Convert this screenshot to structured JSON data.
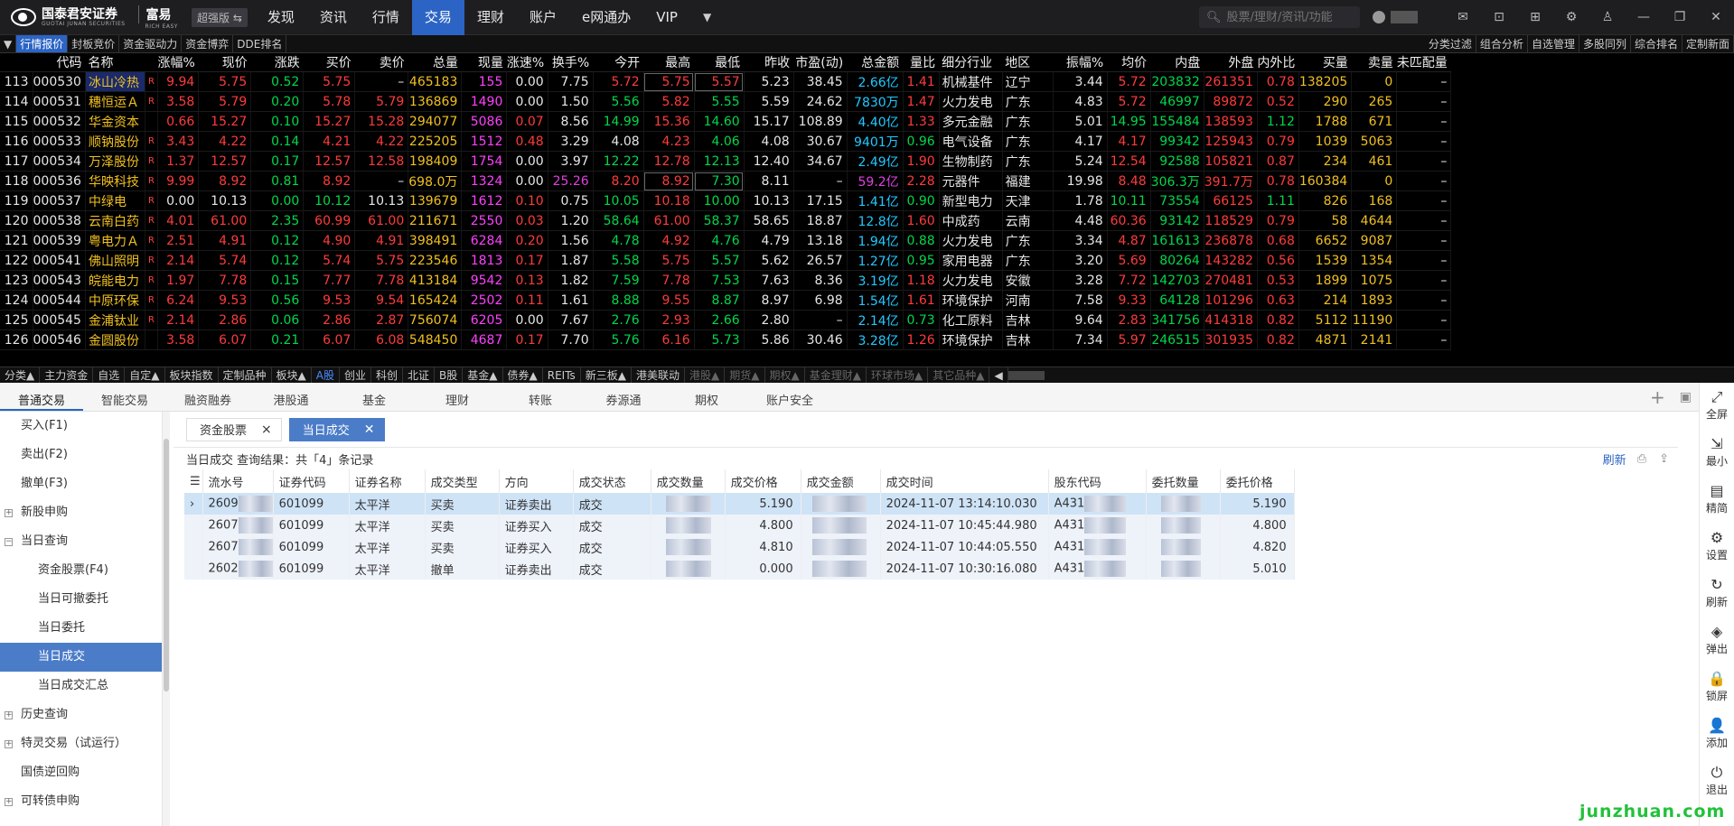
{
  "app": {
    "logo_text": "国泰君安证券",
    "logo_sub": "GUOTAI JUNAN SECURITIES",
    "product": "富易",
    "product_sub": "RICH EASY",
    "edition": "超强版 ⇆"
  },
  "nav": [
    "发现",
    "资讯",
    "行情",
    "交易",
    "理财",
    "账户",
    "e网通办",
    "VIP"
  ],
  "search": {
    "placeholder": "股票/理财/资讯/功能"
  },
  "quote_tabs": [
    "行情报价",
    "封板竞价",
    "资金驱动力",
    "资金博弈",
    "DDE排名"
  ],
  "quote_tabs_right": [
    "分类过滤",
    "组合分析",
    "自选管理",
    "多股同列",
    "综合排名",
    "定制新面"
  ],
  "columns": [
    "",
    "代码",
    "名称",
    "",
    "涨幅%",
    "现价",
    "涨跌",
    "买价",
    "卖价",
    "总量",
    "现量",
    "涨速%",
    "换手%",
    "今开",
    "最高",
    "最低",
    "昨收",
    "市盈(动)",
    "总金额",
    "量比",
    "细分行业",
    "地区",
    "振幅%",
    "均价",
    "内盘",
    "外盘",
    "内外比",
    "买量",
    "卖量",
    "未匹配量"
  ],
  "rows": [
    [
      "113",
      "000530",
      "冰山冷热",
      "R",
      "9.94",
      "5.75",
      "0.52",
      "5.75",
      "–",
      "465183",
      "155",
      "0.00",
      "7.75",
      "5.72",
      "5.75",
      "5.57",
      "5.23",
      "38.45",
      "2.66亿",
      "1.41",
      "机械基件",
      "辽宁",
      "3.44",
      "5.72",
      "203832",
      "261351",
      "0.78",
      "138205",
      "0",
      "–"
    ],
    [
      "114",
      "000531",
      "穗恒运Ａ",
      "R",
      "3.58",
      "5.79",
      "0.20",
      "5.78",
      "5.79",
      "136869",
      "1490",
      "0.00",
      "1.50",
      "5.56",
      "5.82",
      "5.55",
      "5.59",
      "24.62",
      "7830万",
      "1.47",
      "火力发电",
      "广东",
      "4.83",
      "5.72",
      "46997",
      "89872",
      "0.52",
      "290",
      "265",
      "–"
    ],
    [
      "115",
      "000532",
      "华金资本",
      "",
      "0.66",
      "15.27",
      "0.10",
      "15.27",
      "15.28",
      "294077",
      "5086",
      "0.07",
      "8.56",
      "14.99",
      "15.36",
      "14.60",
      "15.17",
      "108.89",
      "4.40亿",
      "1.33",
      "多元金融",
      "广东",
      "5.01",
      "14.95",
      "155484",
      "138593",
      "1.12",
      "1788",
      "671",
      "–"
    ],
    [
      "116",
      "000533",
      "顺钠股份",
      "R",
      "3.43",
      "4.22",
      "0.14",
      "4.21",
      "4.22",
      "225205",
      "1512",
      "0.48",
      "3.29",
      "4.08",
      "4.23",
      "4.06",
      "4.08",
      "30.67",
      "9401万",
      "0.96",
      "电气设备",
      "广东",
      "4.17",
      "4.17",
      "99342",
      "125943",
      "0.79",
      "1039",
      "5063",
      "–"
    ],
    [
      "117",
      "000534",
      "万泽股份",
      "R",
      "1.37",
      "12.57",
      "0.17",
      "12.57",
      "12.58",
      "198409",
      "1754",
      "0.00",
      "3.97",
      "12.22",
      "12.78",
      "12.13",
      "12.40",
      "34.67",
      "2.49亿",
      "1.90",
      "生物制药",
      "广东",
      "5.24",
      "12.54",
      "92588",
      "105821",
      "0.87",
      "234",
      "461",
      "–"
    ],
    [
      "118",
      "000536",
      "华映科技",
      "R",
      "9.99",
      "8.92",
      "0.81",
      "8.92",
      "–",
      "698.0万",
      "1324",
      "0.00",
      "25.26",
      "8.20",
      "8.92",
      "7.30",
      "8.11",
      "–",
      "59.2亿",
      "2.28",
      "元器件",
      "福建",
      "19.98",
      "8.48",
      "306.3万",
      "391.7万",
      "0.78",
      "160384",
      "0",
      "–"
    ],
    [
      "119",
      "000537",
      "中绿电",
      "R",
      "0.00",
      "10.13",
      "0.00",
      "10.12",
      "10.13",
      "139679",
      "1612",
      "0.10",
      "0.75",
      "10.05",
      "10.18",
      "10.00",
      "10.13",
      "17.15",
      "1.41亿",
      "0.90",
      "新型电力",
      "天津",
      "1.78",
      "10.11",
      "73554",
      "66125",
      "1.11",
      "826",
      "168",
      "–"
    ],
    [
      "120",
      "000538",
      "云南白药",
      "R",
      "4.01",
      "61.00",
      "2.35",
      "60.99",
      "61.00",
      "211671",
      "2550",
      "0.03",
      "1.20",
      "58.64",
      "61.00",
      "58.37",
      "58.65",
      "18.87",
      "12.8亿",
      "1.60",
      "中成药",
      "云南",
      "4.48",
      "60.36",
      "93142",
      "118529",
      "0.79",
      "58",
      "4644",
      "–"
    ],
    [
      "121",
      "000539",
      "粤电力Ａ",
      "R",
      "2.51",
      "4.91",
      "0.12",
      "4.90",
      "4.91",
      "398491",
      "6284",
      "0.20",
      "1.56",
      "4.78",
      "4.92",
      "4.76",
      "4.79",
      "13.18",
      "1.94亿",
      "0.88",
      "火力发电",
      "广东",
      "3.34",
      "4.87",
      "161613",
      "236878",
      "0.68",
      "6652",
      "9087",
      "–"
    ],
    [
      "122",
      "000541",
      "佛山照明",
      "R",
      "2.14",
      "5.74",
      "0.12",
      "5.74",
      "5.75",
      "223546",
      "1813",
      "0.17",
      "1.87",
      "5.58",
      "5.75",
      "5.57",
      "5.62",
      "26.57",
      "1.27亿",
      "0.95",
      "家用电器",
      "广东",
      "3.20",
      "5.69",
      "80264",
      "143282",
      "0.56",
      "1539",
      "1354",
      "–"
    ],
    [
      "123",
      "000543",
      "皖能电力",
      "R",
      "1.97",
      "7.78",
      "0.15",
      "7.77",
      "7.78",
      "413184",
      "9542",
      "0.13",
      "1.82",
      "7.59",
      "7.78",
      "7.53",
      "7.63",
      "8.36",
      "3.19亿",
      "1.18",
      "火力发电",
      "安徽",
      "3.28",
      "7.72",
      "142703",
      "270481",
      "0.53",
      "1899",
      "1075",
      "–"
    ],
    [
      "124",
      "000544",
      "中原环保",
      "R",
      "6.24",
      "9.53",
      "0.56",
      "9.53",
      "9.54",
      "165424",
      "2502",
      "0.11",
      "1.61",
      "8.88",
      "9.55",
      "8.87",
      "8.97",
      "6.98",
      "1.54亿",
      "1.61",
      "环境保护",
      "河南",
      "7.58",
      "9.33",
      "64128",
      "101296",
      "0.63",
      "214",
      "1893",
      "–"
    ],
    [
      "125",
      "000545",
      "金浦钛业",
      "R",
      "2.14",
      "2.86",
      "0.06",
      "2.86",
      "2.87",
      "756074",
      "6205",
      "0.00",
      "7.67",
      "2.76",
      "2.93",
      "2.66",
      "2.80",
      "–",
      "2.14亿",
      "0.73",
      "化工原料",
      "吉林",
      "9.64",
      "2.83",
      "341756",
      "414318",
      "0.82",
      "5112",
      "11190",
      "–"
    ],
    [
      "126",
      "000546",
      "金圆股份",
      "",
      "3.58",
      "6.07",
      "0.21",
      "6.07",
      "6.08",
      "548450",
      "4687",
      "0.17",
      "7.70",
      "5.76",
      "6.16",
      "5.73",
      "5.86",
      "30.46",
      "3.28亿",
      "1.26",
      "环境保护",
      "吉林",
      "7.34",
      "5.97",
      "246515",
      "301935",
      "0.82",
      "4871",
      "2141",
      "–"
    ]
  ],
  "categories": [
    "分类▲",
    "主力资金",
    "自选",
    "自定▲",
    "板块指数",
    "定制品种",
    "板块▲",
    "A股",
    "创业",
    "科创",
    "北证",
    "B股",
    "基金▲",
    "债券▲",
    "REITs",
    "新三板▲",
    "港美联动",
    "港股▲",
    "期货▲",
    "期权▲",
    "基金理财▲",
    "环球市场▲",
    "其它品种▲"
  ],
  "trade_tabs": [
    "普通交易",
    "智能交易",
    "融资融券",
    "港股通",
    "基金",
    "理财",
    "转账",
    "券源通",
    "期权",
    "账户安全"
  ],
  "sidebar": [
    {
      "label": "买入(F1)",
      "level": 0,
      "tog": ""
    },
    {
      "label": "卖出(F2)",
      "level": 0,
      "tog": ""
    },
    {
      "label": "撤单(F3)",
      "level": 0,
      "tog": ""
    },
    {
      "label": "新股申购",
      "level": 0,
      "tog": "+"
    },
    {
      "label": "当日查询",
      "level": 0,
      "tog": "−"
    },
    {
      "label": "资金股票(F4)",
      "level": 1,
      "tog": ""
    },
    {
      "label": "当日可撤委托",
      "level": 1,
      "tog": ""
    },
    {
      "label": "当日委托",
      "level": 1,
      "tog": ""
    },
    {
      "label": "当日成交",
      "level": 1,
      "tog": "",
      "active": true
    },
    {
      "label": "当日成交汇总",
      "level": 1,
      "tog": ""
    },
    {
      "label": "历史查询",
      "level": 0,
      "tog": "+"
    },
    {
      "label": "特灵交易（试运行）",
      "level": 0,
      "tog": "+"
    },
    {
      "label": "国债逆回购",
      "level": 0,
      "tog": ""
    },
    {
      "label": "可转债申购",
      "level": 0,
      "tog": "+"
    }
  ],
  "sub_tabs": [
    "资金股票",
    "当日成交"
  ],
  "result": {
    "title": "当日成交",
    "text": "查询结果：共「4」条记录",
    "refresh": "刷新"
  },
  "deal_columns": [
    "",
    "流水号",
    "证券代码",
    "证券名称",
    "成交类型",
    "方向",
    "成交状态",
    "成交数量",
    "成交价格",
    "成交金额",
    "成交时间",
    "股东代码",
    "委托数量",
    "委托价格"
  ],
  "deals": [
    {
      "id": "2609",
      "code": "601099",
      "name": "太平洋",
      "type": "买卖",
      "dir": "证券卖出",
      "dir_kind": "sell",
      "status": "成交",
      "price": "5.190",
      "time": "2024-11-07 13:14:10.030",
      "holder": "A431",
      "order_price": "5.190"
    },
    {
      "id": "2607",
      "code": "601099",
      "name": "太平洋",
      "type": "买卖",
      "dir": "证券买入",
      "dir_kind": "buy",
      "status": "成交",
      "price": "4.800",
      "time": "2024-11-07 10:45:44.980",
      "holder": "A431",
      "order_price": "4.800"
    },
    {
      "id": "2607",
      "code": "601099",
      "name": "太平洋",
      "type": "买卖",
      "dir": "证券买入",
      "dir_kind": "buy",
      "status": "成交",
      "price": "4.810",
      "time": "2024-11-07 10:44:05.550",
      "holder": "A431",
      "order_price": "4.820"
    },
    {
      "id": "2602",
      "code": "601099",
      "name": "太平洋",
      "type": "撤单",
      "dir": "证券卖出",
      "dir_kind": "sell",
      "status": "成交",
      "price": "0.000",
      "time": "2024-11-07 10:30:16.080",
      "holder": "A431",
      "order_price": "5.010"
    }
  ],
  "right_tools": [
    {
      "label": "全屏",
      "icon": "expand-icon",
      "glyph": "⤢"
    },
    {
      "label": "最小",
      "icon": "minimize-icon",
      "glyph": "⇲"
    },
    {
      "label": "精简",
      "icon": "compact-icon",
      "glyph": "▤"
    },
    {
      "label": "设置",
      "icon": "gear-icon",
      "glyph": "⚙"
    },
    {
      "label": "刷新",
      "icon": "refresh-icon",
      "glyph": "↻"
    },
    {
      "label": "弹出",
      "icon": "layers-icon",
      "glyph": "◈"
    },
    {
      "label": "锁屏",
      "icon": "lock-icon",
      "glyph": "🔒"
    },
    {
      "label": "添加",
      "icon": "add-user-icon",
      "glyph": "👤"
    },
    {
      "label": "退出",
      "icon": "power-icon",
      "glyph": "⏻"
    }
  ],
  "watermark": "junzhuan.com"
}
